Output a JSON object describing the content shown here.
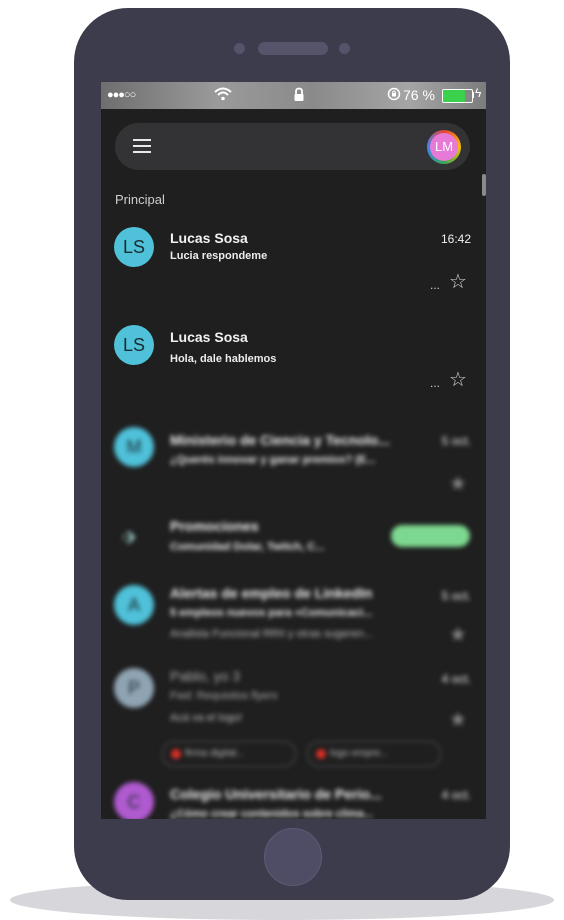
{
  "status_bar": {
    "signal": "●●●○○",
    "battery_pct": "76 %",
    "battery_level": 0.76,
    "icons": [
      "wifi-icon",
      "lock-icon",
      "rotation-lock-icon",
      "battery-icon",
      "charging-icon"
    ]
  },
  "header": {
    "menu_icon": "hamburger-menu-icon",
    "account_initials": "LM"
  },
  "section_label": "Principal",
  "emails": [
    {
      "initials": "LS",
      "sender": "Lucas Sosa",
      "subject": "Lucia respondeme",
      "snippet": "...",
      "time": "16:42",
      "starred": false
    },
    {
      "initials": "LS",
      "sender": "Lucas Sosa",
      "subject": "Hola, dale hablemos",
      "snippet": "...",
      "time": "",
      "starred": false
    },
    {
      "initials": "M",
      "sender": "Ministerio de Ciencia y Tecnolo...",
      "subject": "¿Querés innovar y ganar premios? (E...",
      "snippet": "",
      "time": "5 oct.",
      "starred": false
    },
    {
      "initials": "",
      "sender": "Promociones",
      "subject": "Comunidad Dolar, Twitch, C...",
      "snippet": "",
      "time": "",
      "starred": false
    },
    {
      "initials": "A",
      "sender": "Alertas de empleo de LinkedIn",
      "subject": "5 empleos nuevos para «Comunicaci...",
      "snippet": "Analista Funcional RRII y otras sugeren...",
      "time": "5 oct.",
      "starred": false
    },
    {
      "initials": "P",
      "sender": "Pablo, yo 3",
      "subject": "Fwd: Requisitos flyers",
      "snippet": "Acá va el logo!",
      "time": "4 oct.",
      "starred": false,
      "chips": [
        "firma digital...",
        "logo empre..."
      ]
    },
    {
      "initials": "C",
      "sender": "Colegio Universitario de Perio...",
      "subject": "¿Cómo crear contenidos sobre clima...",
      "snippet": "",
      "time": "4 oct.",
      "starred": false
    }
  ],
  "colors": {
    "phone_body": "#3d3c4c",
    "screen_bg": "#1f1f1f",
    "avatar_ls": "#4fc1d9",
    "account_avatar": "#e77ad6",
    "battery_fill": "#3bd14c",
    "promo_pill": "#7dd88f"
  }
}
